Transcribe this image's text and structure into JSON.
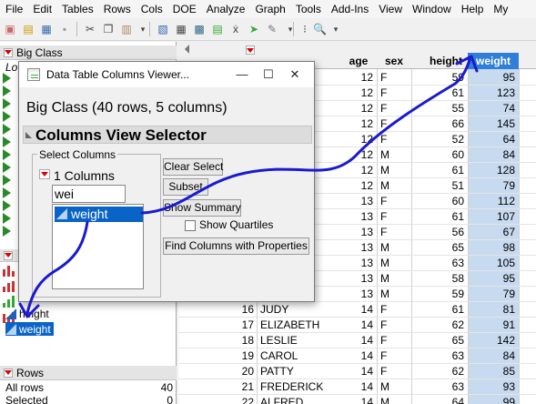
{
  "menubar": [
    "File",
    "Edit",
    "Tables",
    "Rows",
    "Cols",
    "DOE",
    "Analyze",
    "Graph",
    "Tools",
    "Add-Ins",
    "View",
    "Window",
    "Help",
    "My"
  ],
  "left_panel": {
    "table_name": "Big Class",
    "loc_fragment": "Lo",
    "column_items": [
      "height",
      "weight"
    ],
    "rows_header": "Rows",
    "rows_stats": [
      {
        "label": "All rows",
        "value": "40"
      },
      {
        "label": "Selected",
        "value": "0"
      }
    ]
  },
  "grid": {
    "headers": [
      "age",
      "sex",
      "height",
      "weight"
    ],
    "rows": [
      {
        "num": "",
        "name": "",
        "age": "12",
        "sex": "F",
        "height": "59",
        "weight": "95"
      },
      {
        "num": "",
        "name": "",
        "age": "12",
        "sex": "F",
        "height": "61",
        "weight": "123"
      },
      {
        "num": "",
        "name": "",
        "age": "12",
        "sex": "F",
        "height": "55",
        "weight": "74"
      },
      {
        "num": "",
        "name": "",
        "age": "12",
        "sex": "F",
        "height": "66",
        "weight": "145"
      },
      {
        "num": "",
        "name": "",
        "age": "12",
        "sex": "F",
        "height": "52",
        "weight": "64"
      },
      {
        "num": "",
        "name": "",
        "age": "12",
        "sex": "M",
        "height": "60",
        "weight": "84"
      },
      {
        "num": "",
        "name": "",
        "age": "12",
        "sex": "M",
        "height": "61",
        "weight": "128"
      },
      {
        "num": "",
        "name": "",
        "age": "12",
        "sex": "M",
        "height": "51",
        "weight": "79"
      },
      {
        "num": "",
        "name": "",
        "age": "13",
        "sex": "F",
        "height": "60",
        "weight": "112"
      },
      {
        "num": "",
        "name": "",
        "age": "13",
        "sex": "F",
        "height": "61",
        "weight": "107"
      },
      {
        "num": "",
        "name": "",
        "age": "13",
        "sex": "F",
        "height": "56",
        "weight": "67"
      },
      {
        "num": "",
        "name": "",
        "age": "13",
        "sex": "M",
        "height": "65",
        "weight": "98"
      },
      {
        "num": "",
        "name": "",
        "age": "13",
        "sex": "M",
        "height": "63",
        "weight": "105"
      },
      {
        "num": "",
        "name": "",
        "age": "13",
        "sex": "M",
        "height": "58",
        "weight": "95"
      },
      {
        "num": "",
        "name": "",
        "age": "13",
        "sex": "M",
        "height": "59",
        "weight": "79"
      },
      {
        "num": "16",
        "name": "JUDY",
        "age": "14",
        "sex": "F",
        "height": "61",
        "weight": "81"
      },
      {
        "num": "17",
        "name": "ELIZABETH",
        "age": "14",
        "sex": "F",
        "height": "62",
        "weight": "91"
      },
      {
        "num": "18",
        "name": "LESLIE",
        "age": "14",
        "sex": "F",
        "height": "65",
        "weight": "142"
      },
      {
        "num": "19",
        "name": "CAROL",
        "age": "14",
        "sex": "F",
        "height": "63",
        "weight": "84"
      },
      {
        "num": "20",
        "name": "PATTY",
        "age": "14",
        "sex": "F",
        "height": "62",
        "weight": "85"
      },
      {
        "num": "21",
        "name": "FREDERICK",
        "age": "14",
        "sex": "M",
        "height": "63",
        "weight": "93"
      },
      {
        "num": "22",
        "name": "ALFRED",
        "age": "14",
        "sex": "M",
        "height": "64",
        "weight": "99"
      }
    ]
  },
  "dialog": {
    "title": "Data Table Columns Viewer...",
    "subtitle": "Big Class (40 rows, 5 columns)",
    "section_title": "Columns View Selector",
    "select_columns_label": "Select Columns",
    "columns_count": "1 Columns",
    "filter_value": "wei",
    "list_items": [
      "weight"
    ],
    "buttons": {
      "clear_select": "Clear Select",
      "subset": "Subset",
      "show_summary": "Show Summary",
      "find_columns": "Find Columns with Properties"
    },
    "show_quartiles_label": "Show Quartiles",
    "window_buttons": {
      "minimize": "—",
      "maximize": "☐",
      "close": "✕"
    }
  },
  "colors": {
    "selection": "#0a64c8",
    "selected_column_bg": "#c8daf0",
    "annotation": "#1a1ad0"
  }
}
